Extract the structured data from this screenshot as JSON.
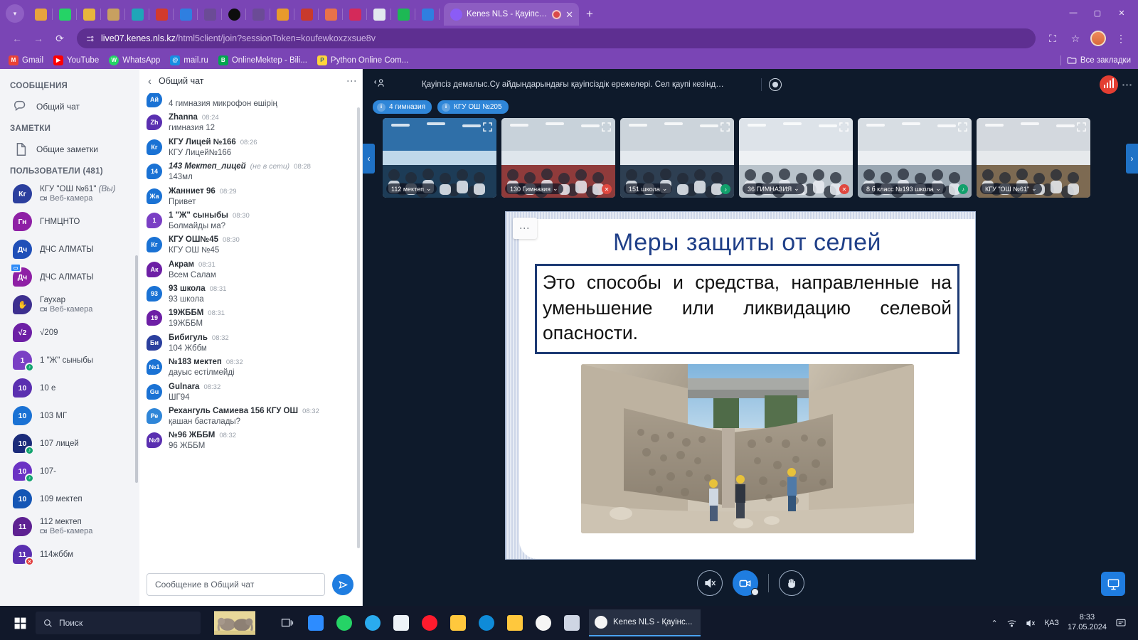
{
  "browser": {
    "tab_title": "Kenes NLS - Қауіпсіз демал",
    "url_host": "live07.kenes.nls.kz",
    "url_path": "/html5client/join?sessionToken=koufewkoxzxsue8v",
    "new_tab_label": "+",
    "close_label": "✕",
    "minimize_label": "—",
    "maximize_label": "▢",
    "window_close_label": "✕",
    "bookmarks": [
      {
        "label": "Gmail",
        "icon": "gmail-icon",
        "color": "#ea4335",
        "glyph": "M"
      },
      {
        "label": "YouTube",
        "icon": "youtube-icon",
        "color": "#ff0000",
        "glyph": "▶"
      },
      {
        "label": "WhatsApp",
        "icon": "whatsapp-icon",
        "color": "#25d366",
        "glyph": "W"
      },
      {
        "label": "mail.ru",
        "icon": "mailru-icon",
        "color": "#168de2",
        "glyph": "@"
      },
      {
        "label": "OnlineMektep - Bili...",
        "icon": "onlinemektep-icon",
        "color": "#00a650",
        "glyph": "B"
      },
      {
        "label": "Python Online Com...",
        "icon": "python-icon",
        "color": "#ffd43b",
        "glyph": "P"
      }
    ],
    "all_bookmarks_label": "Все закладки"
  },
  "sidebar": {
    "messages_header": "СООБЩЕНИЯ",
    "notes_header": "ЗАМЕТКИ",
    "users_header": "ПОЛЬЗОВАТЕЛИ (481)",
    "public_chat_label": "Общий чат",
    "shared_notes_label": "Общие заметки",
    "users": [
      {
        "initials": "Кг",
        "name": "КГУ \"ОШ №61\"",
        "suffix": "(Вы)",
        "sub": "Веб-камера",
        "color": "#2b3f9e",
        "badge": ""
      },
      {
        "initials": "Гн",
        "name": "ГНМЦНТО",
        "suffix": "",
        "sub": "",
        "color": "#8e1fa5",
        "badge": ""
      },
      {
        "initials": "Дч",
        "name": "ДЧС АЛМАТЫ",
        "suffix": "",
        "sub": "",
        "color": "#1f4fb8",
        "badge": ""
      },
      {
        "initials": "Дч",
        "name": "ДЧС АЛМАТЫ",
        "suffix": "",
        "sub": "",
        "color": "#8e1fa5",
        "badge": "screen"
      },
      {
        "initials": "✋",
        "name": "Гаухар",
        "suffix": "",
        "sub": "Веб-камера",
        "color": "#3d2f8f",
        "badge": ""
      },
      {
        "initials": "√2",
        "name": "√209",
        "suffix": "",
        "sub": "",
        "color": "#6d1fa5",
        "badge": ""
      },
      {
        "initials": "1",
        "name": "1 \"Ж\" сыныбы",
        "suffix": "",
        "sub": "",
        "color": "#7a3fc4",
        "badge": "green"
      },
      {
        "initials": "10",
        "name": "10 е",
        "suffix": "",
        "sub": "",
        "color": "#5a2fb0",
        "badge": ""
      },
      {
        "initials": "10",
        "name": "103 МГ",
        "suffix": "",
        "sub": "",
        "color": "#1a72d4",
        "badge": ""
      },
      {
        "initials": "10",
        "name": "107 лицей",
        "suffix": "",
        "sub": "",
        "color": "#1b2b7a",
        "badge": "green"
      },
      {
        "initials": "10",
        "name": "107-",
        "suffix": "",
        "sub": "",
        "color": "#6b32c4",
        "badge": "green"
      },
      {
        "initials": "10",
        "name": "109 мектеп",
        "suffix": "",
        "sub": "",
        "color": "#1556b5",
        "badge": ""
      },
      {
        "initials": "11",
        "name": "112 мектеп",
        "suffix": "",
        "sub": "Веб-камера",
        "color": "#5e2192",
        "badge": ""
      },
      {
        "initials": "11",
        "name": "114жббм",
        "suffix": "",
        "sub": "",
        "color": "#5a2fb0",
        "badge": "red"
      }
    ]
  },
  "chat": {
    "title": "Общий чат",
    "back_icon": "chevron-left-icon",
    "options_icon": "kebab-menu-icon",
    "input_placeholder": "Сообщение в Общий чат",
    "send_icon": "send-icon",
    "messages": [
      {
        "initials": "Ай",
        "name": "",
        "time": "",
        "text": "4 гимназия микрофон өшірің",
        "color": "#1a72d4",
        "offline": "",
        "italic": false,
        "partial": true
      },
      {
        "initials": "Zh",
        "name": "Zhanna",
        "time": "08:24",
        "text": "гимназия 12",
        "color": "#5a2fb0",
        "offline": "",
        "italic": false
      },
      {
        "initials": "Кг",
        "name": "КГУ Лицей №166",
        "time": "08:26",
        "text": "КГУ Лицей№166",
        "color": "#1a72d4",
        "offline": "",
        "italic": false
      },
      {
        "initials": "14",
        "name": "143 Мектеп_лицей",
        "time": "08:28",
        "text": "143мл",
        "color": "#1a72d4",
        "offline": "(не в сети)",
        "italic": true
      },
      {
        "initials": "Жа",
        "name": "Жанниет 96",
        "time": "08:29",
        "text": "Привет",
        "color": "#1a72d4",
        "offline": "",
        "italic": false
      },
      {
        "initials": "1",
        "name": "1 \"Ж\" сыныбы",
        "time": "08:30",
        "text": "Болмайды ма?",
        "color": "#7a3fc4",
        "offline": "",
        "italic": false
      },
      {
        "initials": "Кг",
        "name": "КГУ ОШ№45",
        "time": "08:30",
        "text": "КГУ ОШ №45",
        "color": "#1a72d4",
        "offline": "",
        "italic": false
      },
      {
        "initials": "Ак",
        "name": "Акрам",
        "time": "08:31",
        "text": "Всем Салам",
        "color": "#6d1fa5",
        "offline": "",
        "italic": false
      },
      {
        "initials": "93",
        "name": "93 школа",
        "time": "08:31",
        "text": "93 школа",
        "color": "#1a72d4",
        "offline": "",
        "italic": false
      },
      {
        "initials": "19",
        "name": "19ЖББМ",
        "time": "08:31",
        "text": "19ЖББМ",
        "color": "#6d1fa5",
        "offline": "",
        "italic": false
      },
      {
        "initials": "Би",
        "name": "Бибигуль",
        "time": "08:32",
        "text": "104 Жббм",
        "color": "#2b3f9e",
        "offline": "",
        "italic": false
      },
      {
        "initials": "№1",
        "name": "№183 мектеп",
        "time": "08:32",
        "text": "дауыс естілмейді",
        "color": "#1a72d4",
        "offline": "",
        "italic": false
      },
      {
        "initials": "Gu",
        "name": "Gulnara",
        "time": "08:32",
        "text": "ШГ94",
        "color": "#1a72d4",
        "offline": "",
        "italic": false
      },
      {
        "initials": "Ре",
        "name": "Рехангуль Самиева 156 КГУ ОШ",
        "time": "08:32",
        "text": "қашан басталады?",
        "color": "#2f86d8",
        "offline": "",
        "italic": false
      },
      {
        "initials": "№9",
        "name": "№96 ЖББМ",
        "time": "08:32",
        "text": "96 ЖББМ",
        "color": "#5a2fb0",
        "offline": "",
        "italic": false
      }
    ]
  },
  "meeting": {
    "title": "Қауіпсіз демалыс.Су айдындарындағы қауіпсіздік ережелері. Сел қаупі кезіндегі халықтың ...",
    "user_list_icon": "user-list-icon",
    "record_icon": "record-icon",
    "signal_icon": "signal-bars-icon",
    "options_icon": "kebab-menu-icon",
    "chips": [
      {
        "label": "4 гимназия",
        "icon": "download-icon"
      },
      {
        "label": "КГУ ОШ №205",
        "icon": "download-icon"
      }
    ],
    "prev_icon": "chevron-left-icon",
    "next_icon": "chevron-right-icon",
    "tiles": [
      {
        "label": "112 мектеп",
        "status": "",
        "sky": "#bfd8ea",
        "wall": "#2f6fa8",
        "floor": "#1d3c57"
      },
      {
        "label": "130 Гимназия",
        "status": "red",
        "sky": "#dfe6ec",
        "wall": "#c8d2da",
        "floor": "#8f3b3b"
      },
      {
        "label": "151 школа",
        "status": "green",
        "sky": "#e4e9ee",
        "wall": "#ccd4db",
        "floor": "#2e3f52"
      },
      {
        "label": "36 ГИМНАЗИЯ",
        "status": "red",
        "sky": "#eef1f4",
        "wall": "#dde3e9",
        "floor": "#b9c3cb"
      },
      {
        "label": "8 б класс №193 школа",
        "status": "green",
        "sky": "#eceff2",
        "wall": "#d7dde3",
        "floor": "#9aa7b2"
      },
      {
        "label": "КГУ \"ОШ №61\"",
        "status": "",
        "sky": "#e6e9ec",
        "wall": "#d3d8de",
        "floor": "#7d6a52"
      }
    ],
    "controls": {
      "mute_label": "mute-speaker-icon",
      "camera_label": "camera-icon",
      "hand_label": "raise-hand-icon",
      "present_label": "presentation-icon"
    },
    "slide": {
      "options_icon": "kebab-menu-icon",
      "title": "Меры защиты от селей",
      "body": "Это способы и средства, направленные на уменьшение или ликвидацию селевой опасности."
    }
  },
  "taskbar": {
    "search_placeholder": "Поиск",
    "start_icon": "windows-start-icon",
    "search_icon": "search-icon",
    "task_view_icon": "task-view-icon",
    "active_window": "Kenes NLS - Қауінс...",
    "apps": [
      {
        "name": "zoom-icon",
        "color": "#2d8cff",
        "glyph": "▣"
      },
      {
        "name": "whatsapp-icon",
        "color": "#25d366",
        "glyph": "✆"
      },
      {
        "name": "telegram-icon",
        "color": "#2aabee",
        "glyph": "✈"
      },
      {
        "name": "paint-icon",
        "color": "#f0f4f8",
        "glyph": "🖌"
      },
      {
        "name": "opera-icon",
        "color": "#ff1b2d",
        "glyph": "O"
      },
      {
        "name": "file-explorer-icon",
        "color": "#ffc83d",
        "glyph": "🗀"
      },
      {
        "name": "edge-icon",
        "color": "#0f8bd8",
        "glyph": "e"
      },
      {
        "name": "notes-icon",
        "color": "#ffc83d",
        "glyph": "▮"
      },
      {
        "name": "chrome-icon",
        "color": "#f5f5f5",
        "glyph": "◉"
      },
      {
        "name": "python-icon",
        "color": "#3776ab",
        "glyph": "P"
      }
    ],
    "tray": {
      "chevron": "⌃",
      "network": "network-icon",
      "volume": "volume-muted-icon",
      "language": "ҚАЗ",
      "time": "8:33",
      "date": "17.05.2024",
      "notifications": "notification-icon"
    }
  }
}
